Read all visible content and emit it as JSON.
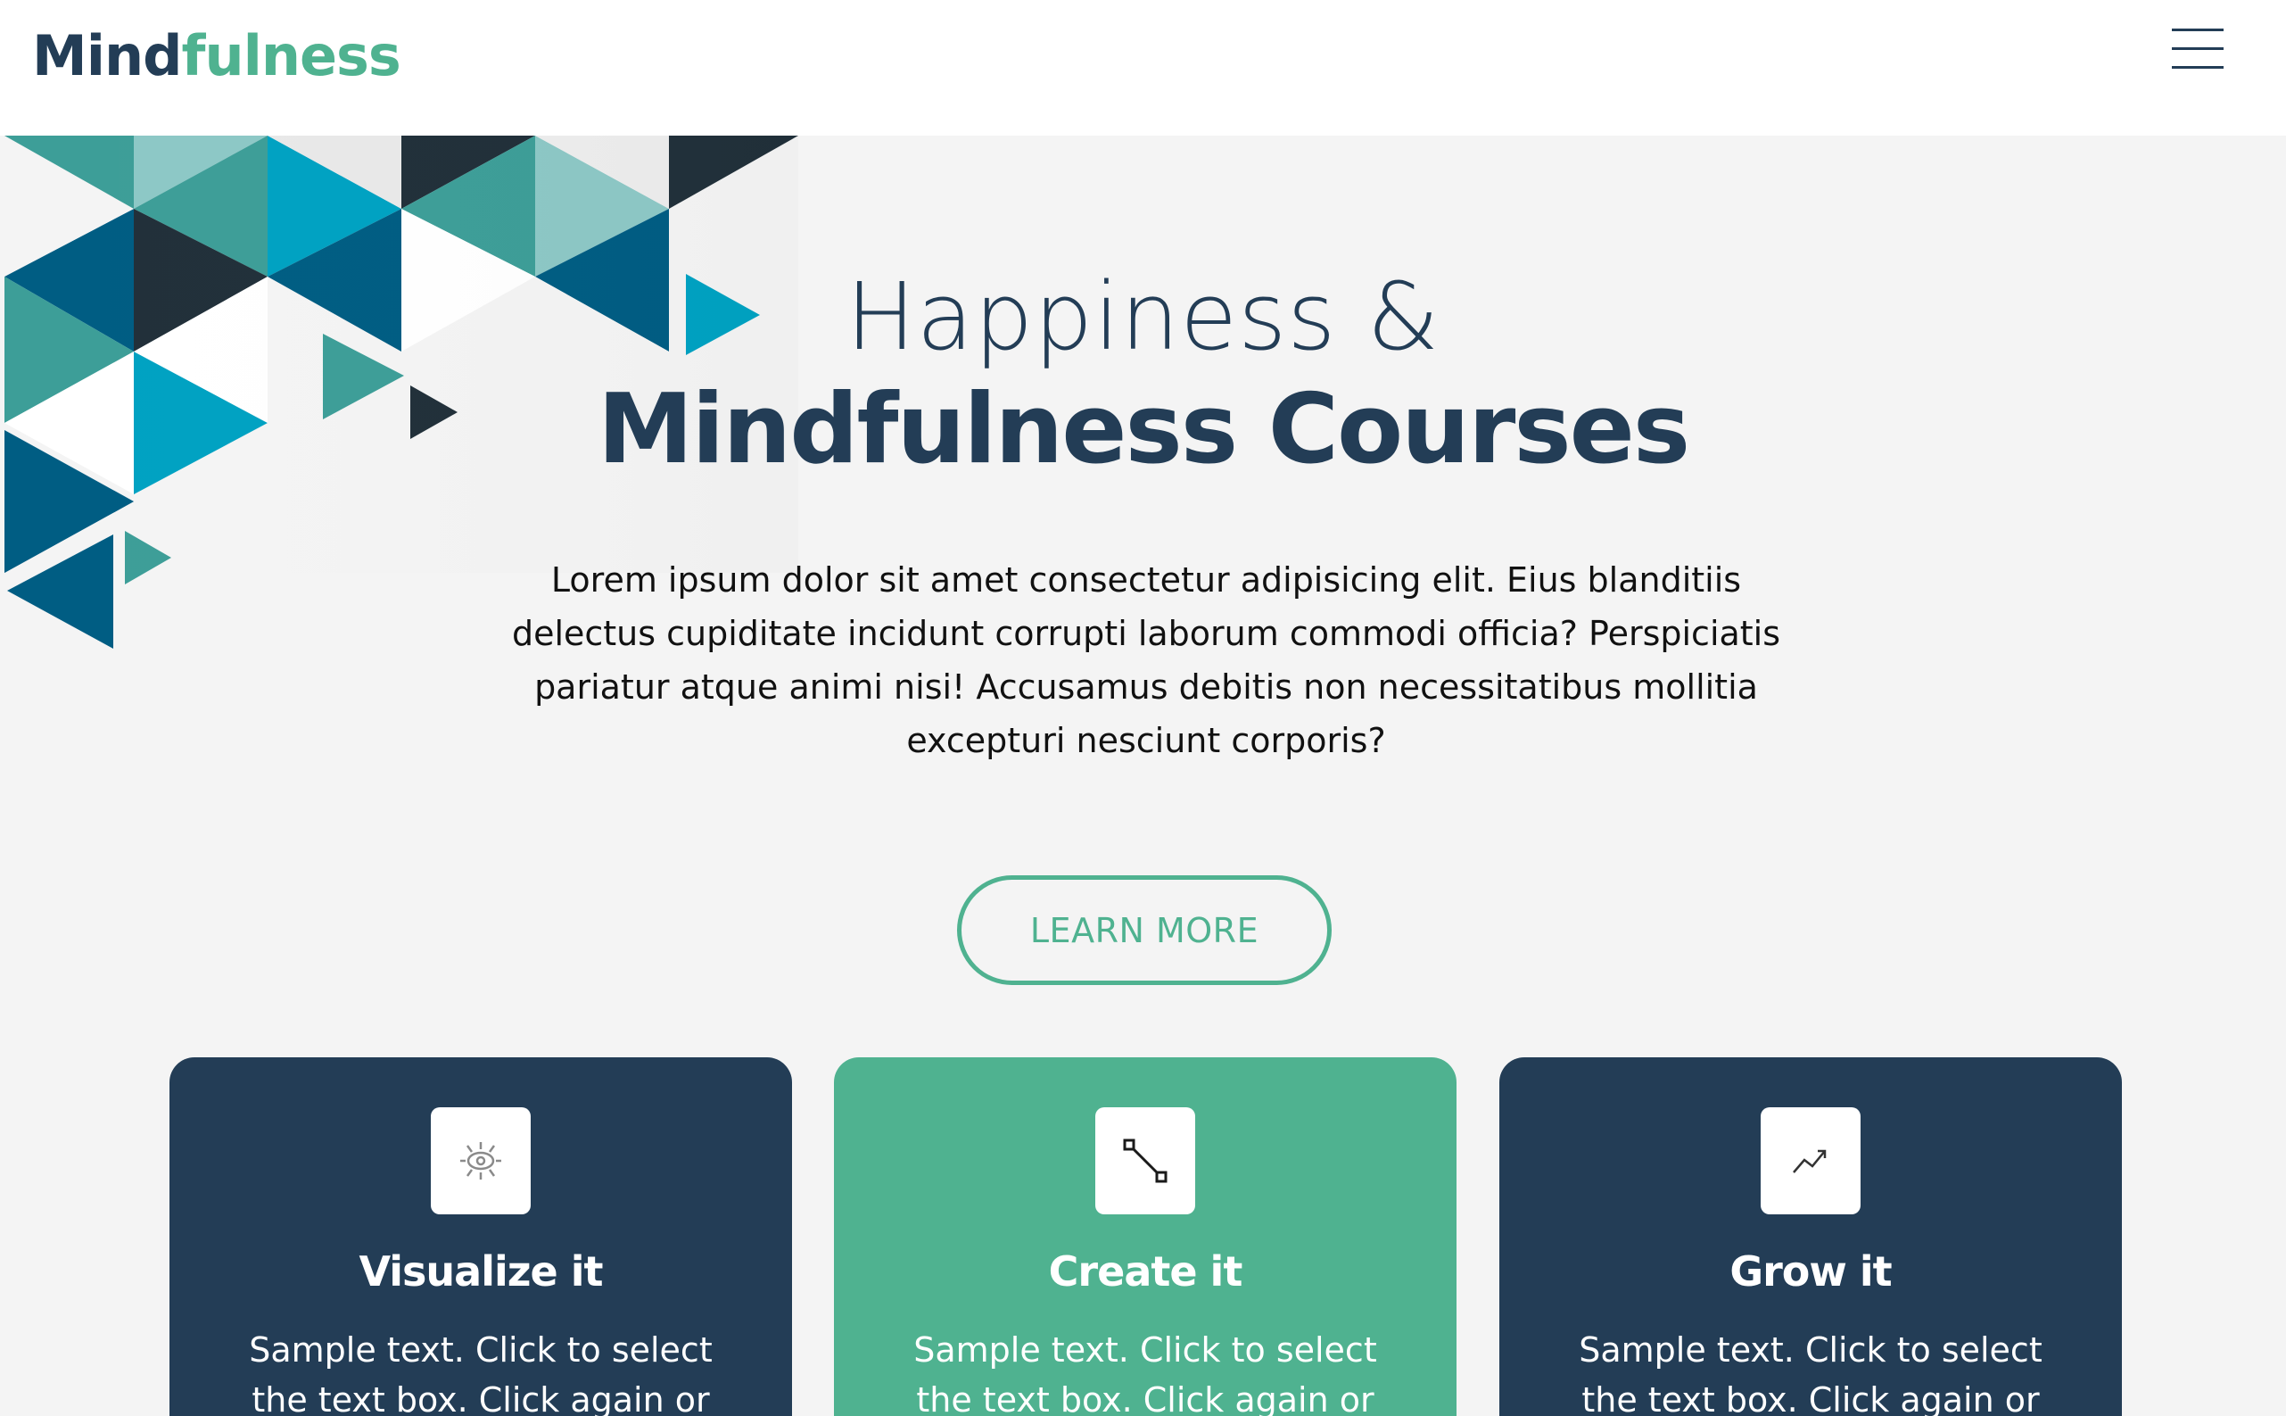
{
  "header": {
    "logo_part1": "Mind",
    "logo_part2": "fulness",
    "menu_icon": "hamburger-menu-icon"
  },
  "hero": {
    "title_line1": "Happiness &",
    "title_line2": "Mindfulness Courses",
    "body": "Lorem ipsum dolor sit amet consectetur adipisicing elit. Eius blanditiis delectus cupiditate incidunt corrupti laborum commodi officia? Perspiciatis pariatur atque animi nisi! Accusamus debitis non necessitatibus mollitia excepturi nesciunt corporis?",
    "button_label": "LEARN MORE"
  },
  "cards": [
    {
      "icon": "eye-vision-icon",
      "title": "Visualize it",
      "text": "Sample text. Click to select the text box. Click again or"
    },
    {
      "icon": "node-connector-icon",
      "title": "Create it",
      "text": "Sample text. Click to select the text box. Click again or"
    },
    {
      "icon": "trend-up-icon",
      "title": "Grow it",
      "text": "Sample text. Click to select the text box. Click again or"
    }
  ],
  "colors": {
    "navy": "#233d56",
    "green": "#4fb290",
    "background": "#f4f4f4",
    "teal": "#3d9e98",
    "light_teal": "#8dc8c6",
    "cyan": "#00a2c2",
    "deep_blue": "#005d83",
    "charcoal": "#21303a"
  }
}
